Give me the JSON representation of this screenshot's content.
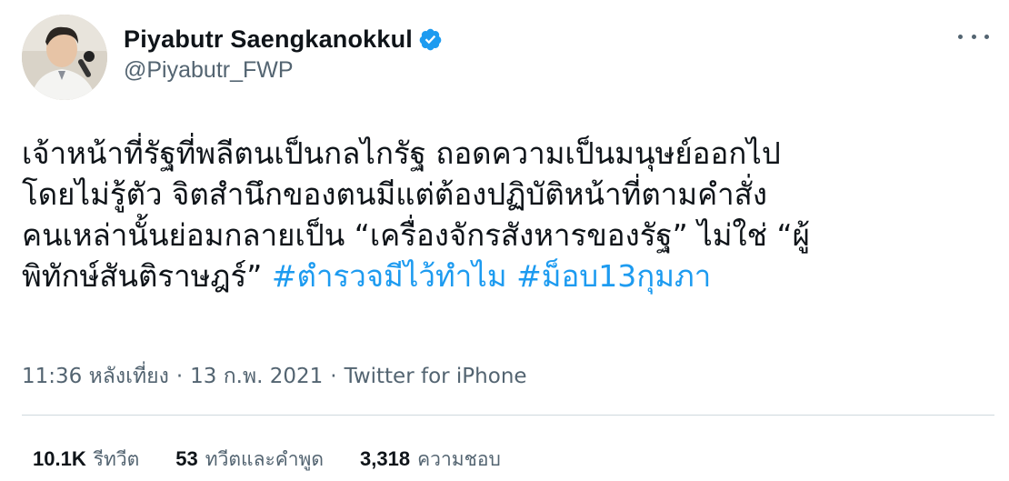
{
  "author": {
    "display_name": "Piyabutr Saengkanokkul",
    "handle": "@Piyabutr_FWP",
    "verified_icon": "verified-badge-icon",
    "avatar_icon": "profile-avatar"
  },
  "tweet": {
    "lines": [
      "เจ้าหน้าที่รัฐที่พลีตนเป็นกลไกรัฐ ถอดความเป็นมนุษย์ออกไป",
      "โดยไม่รู้ตัว จิตสำนึกของตนมีแต่ต้องปฏิบัติหน้าที่ตามคำสั่ง",
      "คนเหล่านั้นย่อมกลายเป็น “เครื่องจักรสังหารของรัฐ” ไม่ใช่ “ผู้",
      "พิทักษ์สันติราษฎร์”"
    ],
    "hashtags": [
      "#ตำรวจมีไว้ทำไม",
      "#ม็อบ13กุมภา"
    ]
  },
  "meta": {
    "time": "11:36 หลังเที่ยง",
    "date": "13 ก.พ. 2021",
    "separator": "·",
    "source": "Twitter for iPhone"
  },
  "stats": {
    "retweets": {
      "value": "10.1K",
      "label": "รีทวีต"
    },
    "quotes": {
      "value": "53",
      "label": "ทวีตและคำพูด"
    },
    "likes": {
      "value": "3,318",
      "label": "ความชอบ"
    }
  },
  "colors": {
    "link": "#1d9bf0",
    "secondary_text": "#536471",
    "primary_text": "#0f1419",
    "divider": "#cfd9de"
  }
}
